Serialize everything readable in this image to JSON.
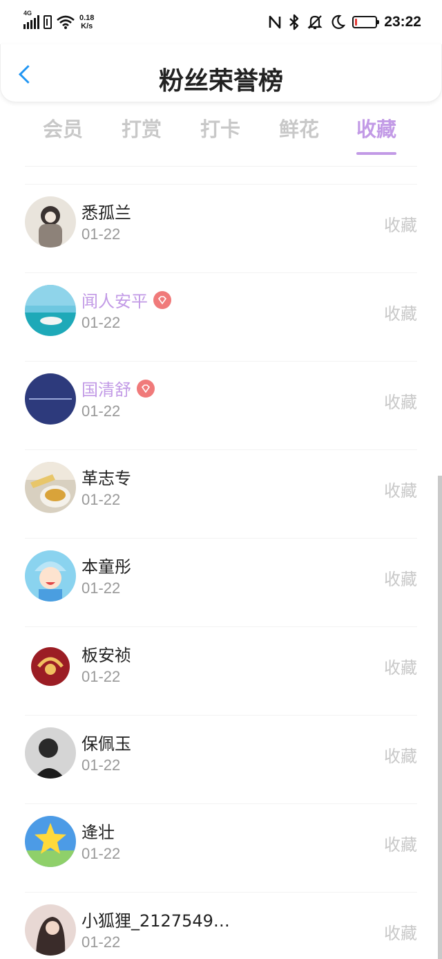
{
  "status_bar": {
    "network": "4G",
    "speed_value": "0.18",
    "speed_unit": "K/s",
    "time": "23:22",
    "icons": [
      "signal-icon",
      "sim-icon",
      "wifi-icon",
      "nfc-icon",
      "bluetooth-icon",
      "mute-icon",
      "moon-icon",
      "battery-icon"
    ]
  },
  "header": {
    "title": "粉丝荣誉榜",
    "back_icon": "back-arrow-icon"
  },
  "accent_color": "#c29ae6",
  "tabs": [
    {
      "label": "会员",
      "active": false
    },
    {
      "label": "打赏",
      "active": false
    },
    {
      "label": "打卡",
      "active": false
    },
    {
      "label": "鲜花",
      "active": false
    },
    {
      "label": "收藏",
      "active": true
    }
  ],
  "list": [
    {
      "name": "悉孤兰",
      "date": "01-22",
      "action": "收藏",
      "vip": false
    },
    {
      "name": "闻人安平",
      "date": "01-22",
      "action": "收藏",
      "vip": true
    },
    {
      "name": "国清舒",
      "date": "01-22",
      "action": "收藏",
      "vip": true
    },
    {
      "name": "革志专",
      "date": "01-22",
      "action": "收藏",
      "vip": false
    },
    {
      "name": "本童彤",
      "date": "01-22",
      "action": "收藏",
      "vip": false
    },
    {
      "name": "板安祯",
      "date": "01-22",
      "action": "收藏",
      "vip": false
    },
    {
      "name": "保佩玉",
      "date": "01-22",
      "action": "收藏",
      "vip": false
    },
    {
      "name": "逄壮",
      "date": "01-22",
      "action": "收藏",
      "vip": false
    },
    {
      "name": "小狐狸_2127549…",
      "date": "01-22",
      "action": "收藏",
      "vip": false
    }
  ]
}
